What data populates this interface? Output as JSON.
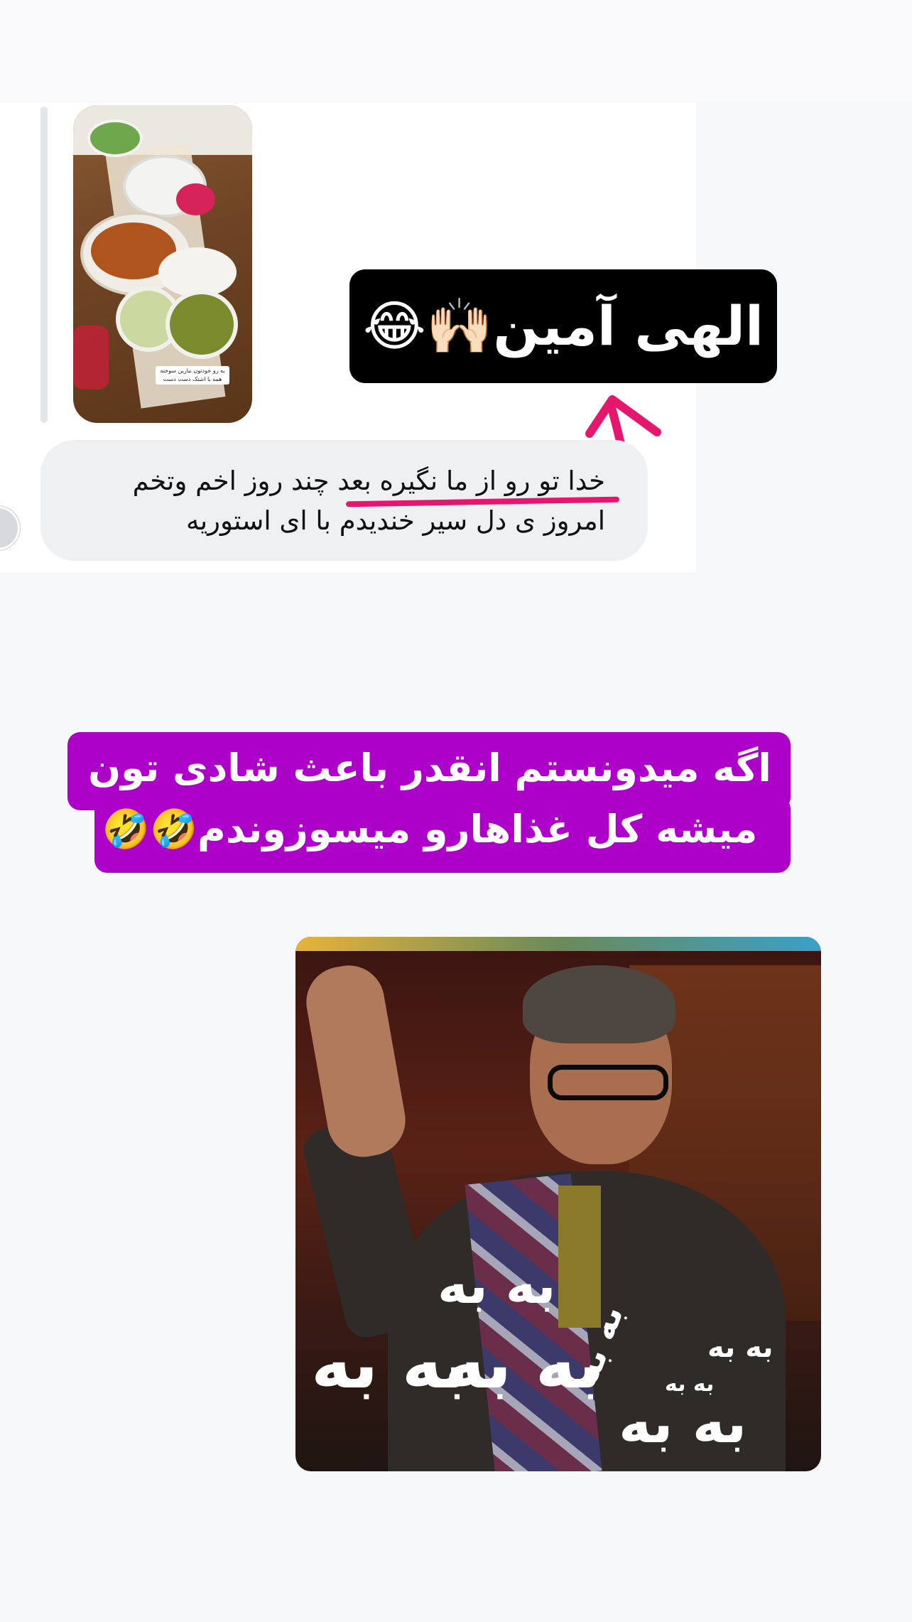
{
  "story_reply": {
    "caption": "به رو خودتون نیارین سوخته همه با اشتک دست دست"
  },
  "sent_sticker": {
    "text": "الهی آمین🙌🏻😂"
  },
  "received_message": {
    "line1": "خدا تو رو از ما نگیره بعد چند روز اخم وتخم",
    "line2": "امروز ی دل سیر خندیدم با ای استوریه"
  },
  "purple_caption": {
    "line1": "اگه میدونستم انقدر باعث شادی تون",
    "line2": "میشه کل غذاهارو میسوزوندم🤣🤣"
  },
  "meme": {
    "words": [
      "به به",
      "به به",
      "به به",
      "به به",
      "به به",
      "به به",
      "به به"
    ]
  },
  "colors": {
    "accent_pink": "#e6166e",
    "caption_purple": "#ad00c9",
    "sticker_black": "#000000"
  }
}
